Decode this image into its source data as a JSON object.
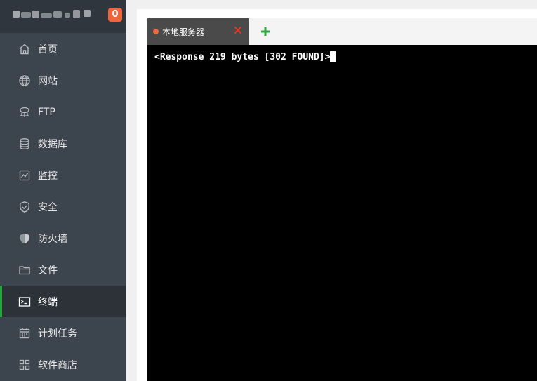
{
  "header": {
    "badge_count": "0"
  },
  "sidebar": {
    "items": [
      {
        "label": "首页",
        "icon": "home-icon"
      },
      {
        "label": "网站",
        "icon": "globe-icon"
      },
      {
        "label": "FTP",
        "icon": "ftp-icon"
      },
      {
        "label": "数据库",
        "icon": "database-icon"
      },
      {
        "label": "监控",
        "icon": "monitor-icon"
      },
      {
        "label": "安全",
        "icon": "shield-check-icon"
      },
      {
        "label": "防火墙",
        "icon": "firewall-shield-icon"
      },
      {
        "label": "文件",
        "icon": "folder-icon"
      },
      {
        "label": "终端",
        "icon": "terminal-icon",
        "active": true
      },
      {
        "label": "计划任务",
        "icon": "calendar-icon"
      },
      {
        "label": "软件商店",
        "icon": "apps-grid-icon"
      }
    ]
  },
  "tabs": [
    {
      "label": "本地服务器",
      "status_color": "#ef6a3e"
    }
  ],
  "terminal": {
    "output": "<Response 219 bytes [302 FOUND]>"
  },
  "colors": {
    "accent": "#20a53a",
    "badge": "#f0663c",
    "sidebar_bg": "#3c444d"
  }
}
